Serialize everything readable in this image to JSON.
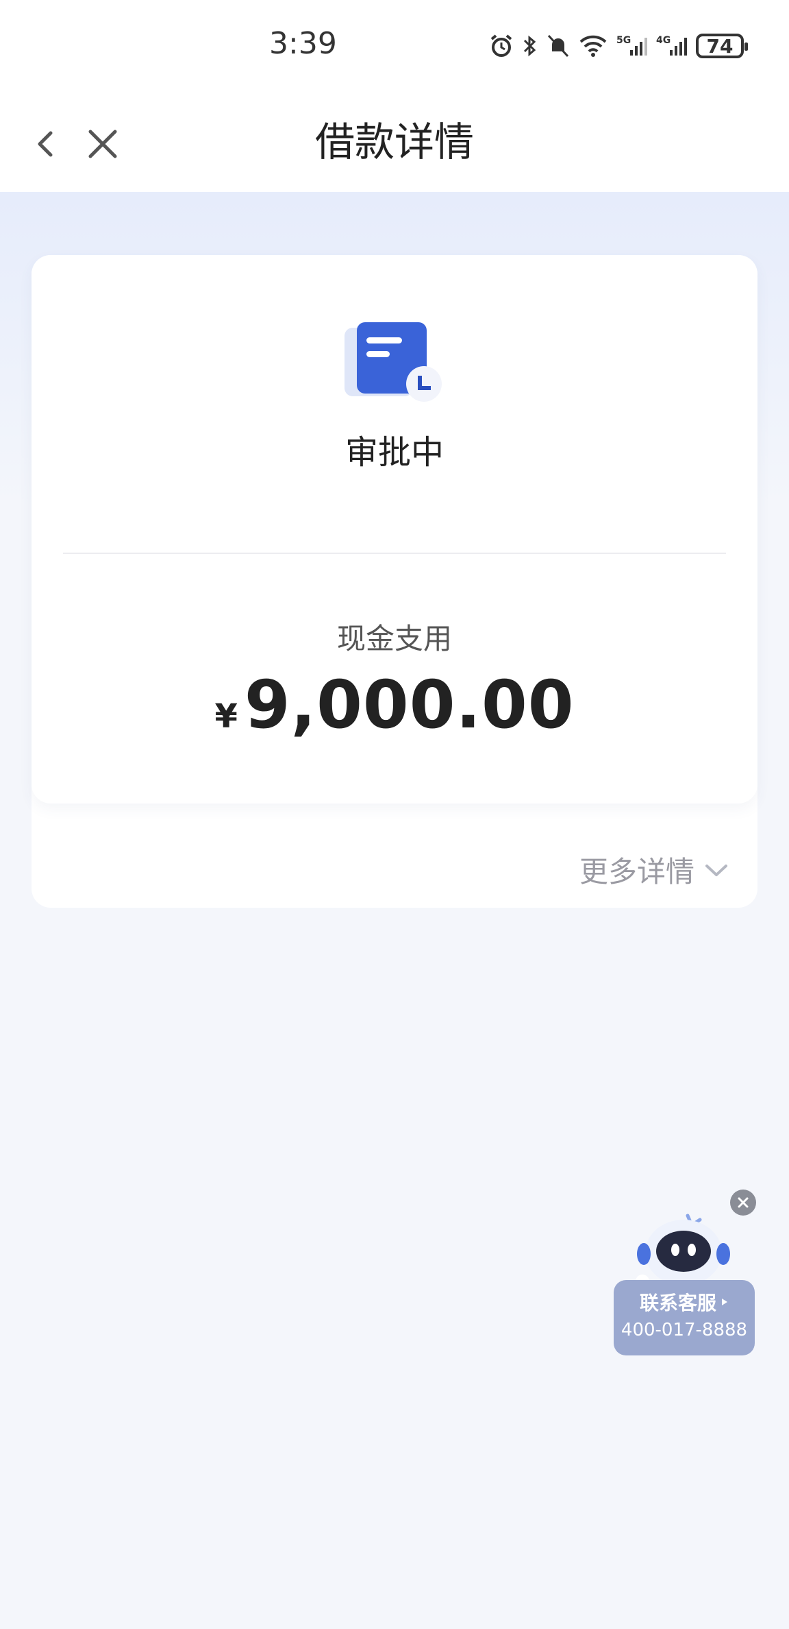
{
  "status_bar": {
    "time": "3:39",
    "battery": "74"
  },
  "nav": {
    "title": "借款详情"
  },
  "card": {
    "status": "审批中",
    "amount_label": "现金支用",
    "currency_symbol": "¥",
    "amount": "9,000.00",
    "more_details": "更多详情"
  },
  "customer_service": {
    "title": "联系客服",
    "phone": "400-017-8888"
  },
  "colors": {
    "primary_blue": "#3a63d8",
    "background": "#f4f6fb",
    "cs_panel": "#9aa8cf"
  }
}
